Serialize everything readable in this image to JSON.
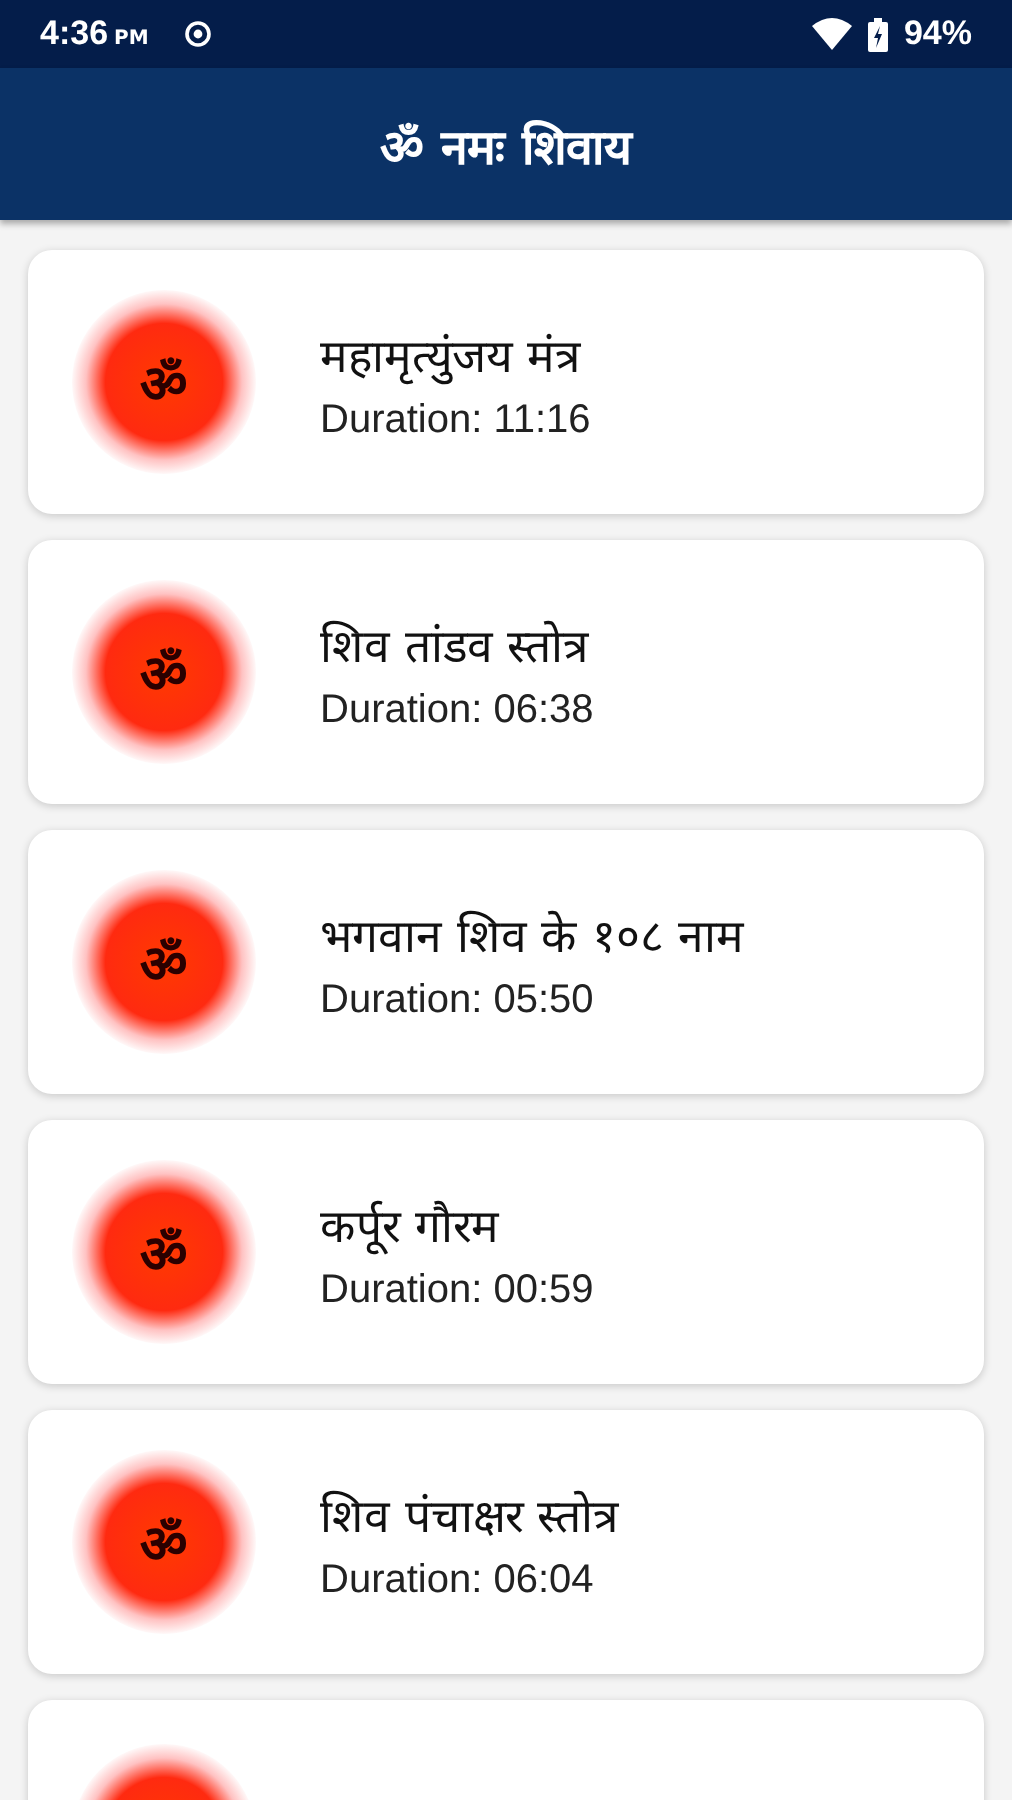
{
  "status_bar": {
    "time": "4:36",
    "ampm": "PM",
    "battery": "94%"
  },
  "header": {
    "title": "ॐ नमः शिवाय"
  },
  "tracks": [
    {
      "cut_off": false,
      "symbol": "ॐ",
      "title": "महामृत्युंजय मंत्र",
      "duration": "Duration: 11:16"
    },
    {
      "cut_off": false,
      "symbol": "ॐ",
      "title": "शिव तांडव स्तोत्र",
      "duration": "Duration: 06:38"
    },
    {
      "cut_off": false,
      "symbol": "ॐ",
      "title": "भगवान शिव के १०८ नाम",
      "duration": "Duration: 05:50"
    },
    {
      "cut_off": false,
      "symbol": "ॐ",
      "title": "कर्पूर गौरम",
      "duration": "Duration: 00:59"
    },
    {
      "cut_off": false,
      "symbol": "ॐ",
      "title": "शिव पंचाक्षर स्तोत्र",
      "duration": "Duration: 06:04"
    },
    {
      "cut_off": true
    }
  ]
}
